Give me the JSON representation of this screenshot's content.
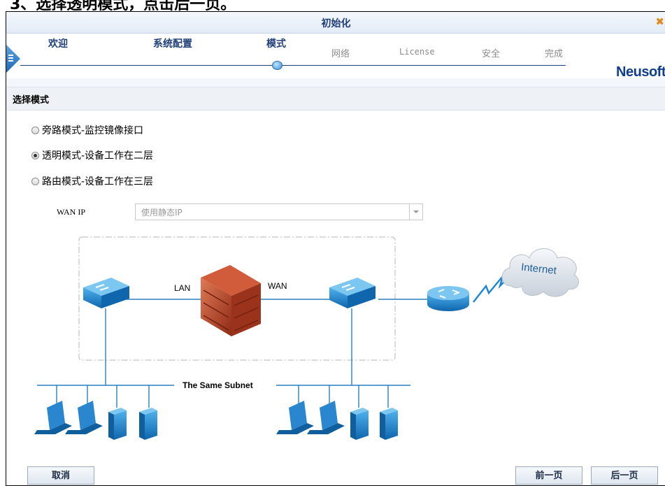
{
  "caption": "3、选择透明模式，点击后一页。",
  "window": {
    "title": "初始化",
    "logo": "Neusoft"
  },
  "steps": [
    {
      "label": "欢迎",
      "state": "done"
    },
    {
      "label": "系统配置",
      "state": "done"
    },
    {
      "label": "模式",
      "state": "current"
    },
    {
      "label": "网络",
      "state": "todo"
    },
    {
      "label": "License",
      "state": "todo"
    },
    {
      "label": "安全",
      "state": "todo"
    },
    {
      "label": "完成",
      "state": "todo"
    }
  ],
  "section_title": "选择模式",
  "modes": [
    {
      "label": "旁路模式-监控镜像接口",
      "selected": false
    },
    {
      "label": "透明模式-设备工作在二层",
      "selected": true
    },
    {
      "label": "路由模式-设备工作在三层",
      "selected": false
    }
  ],
  "wan": {
    "label": "WAN IP",
    "value": "使用静态IP"
  },
  "diagram": {
    "lan_label": "LAN",
    "wan_label": "WAN",
    "subnet_label": "The Same Subnet",
    "cloud_label": "Internet"
  },
  "buttons": {
    "cancel": "取消",
    "prev": "前一页",
    "next": "后一页"
  },
  "colors": {
    "accent": "#1f3f78",
    "device": "#1a7dc4",
    "wall": "#b8452a"
  }
}
